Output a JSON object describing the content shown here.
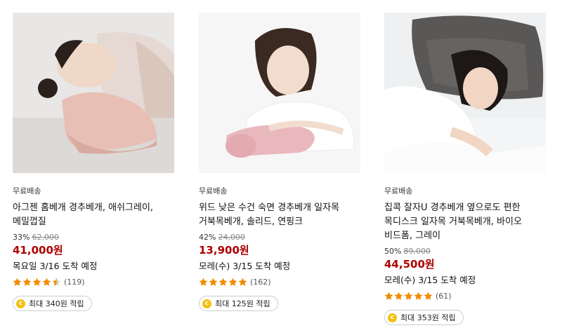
{
  "products": [
    {
      "image_alt": "pillow-product-image",
      "free_shipping": "무료배송",
      "title": "아그젠 홈베개 경추베개, 애쉬그레이, 메밀껍질",
      "discount": "33%",
      "original_price": "62,000",
      "price": "41,000원",
      "arrival": "목요일 3/16 도착 예정",
      "rating": 4.5,
      "review_count": "(119)",
      "reward": "최대 340원 적립"
    },
    {
      "image_alt": "pillow-product-image",
      "free_shipping": "무료배송",
      "title": "위드 낮은 수건 숙면 경추베개 일자목 거북목베개, 솔리드, 연핑크",
      "discount": "42%",
      "original_price": "24,000",
      "price": "13,900원",
      "arrival": "모레(수) 3/15 도착 예정",
      "rating": 5,
      "review_count": "(162)",
      "reward": "최대 125원 적립"
    },
    {
      "image_alt": "pillow-product-image",
      "free_shipping": "무료배송",
      "title": "집콕 잘자U 경추베개 옆으로도 편한 목디스크 일자목 거북목베개, 바이오 비드폼, 그레이",
      "discount": "50%",
      "original_price": "89,000",
      "price": "44,500원",
      "arrival": "모레(수) 3/15 도착 예정",
      "rating": 5,
      "review_count": "(61)",
      "reward": "최대 353원 적립"
    }
  ],
  "colors": {
    "price": "#ae0000",
    "star": "#f28b00",
    "coin": "#f4c010"
  },
  "icons": {
    "star": "star-icon",
    "coin": "coin-icon"
  }
}
